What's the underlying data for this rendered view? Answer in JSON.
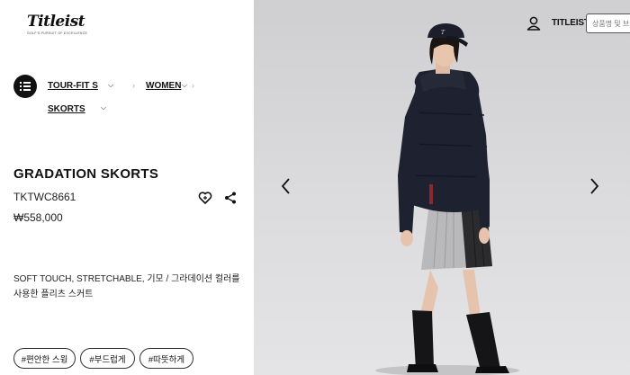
{
  "header": {
    "logo_text": "Titleist",
    "logo_tagline": "GOLF'S PURSUIT OF EXCELLENCE",
    "brand_link": "TITLEIST",
    "search_placeholder": "상품명 및 브랜"
  },
  "breadcrumb": {
    "items": [
      {
        "label": "TOUR-FIT S"
      },
      {
        "label": "WOMEN"
      },
      {
        "label": "SKORTS"
      }
    ]
  },
  "product": {
    "name": "GRADATION SKORTS",
    "code": "TKTWC8661",
    "price": "₩558,000",
    "description": "SOFT TOUCH, STRETCHABLE, 기모 / 그라데이션 컬러를 사용한 플리츠 스커트",
    "tags": [
      "#편안한 스윙",
      "#부드럽게",
      "#따뜻하게"
    ]
  },
  "icons": {
    "menu": "list-icon",
    "wishlist": "heart-icon",
    "share": "share-icon",
    "account": "user-icon",
    "prev": "chevron-left-icon",
    "next": "chevron-right-icon"
  },
  "colors": {
    "jacket": "#1e2230",
    "skirt_light": "#b9b9bb",
    "skirt_dark": "#2b2b2e",
    "background": "#d8d8da"
  }
}
